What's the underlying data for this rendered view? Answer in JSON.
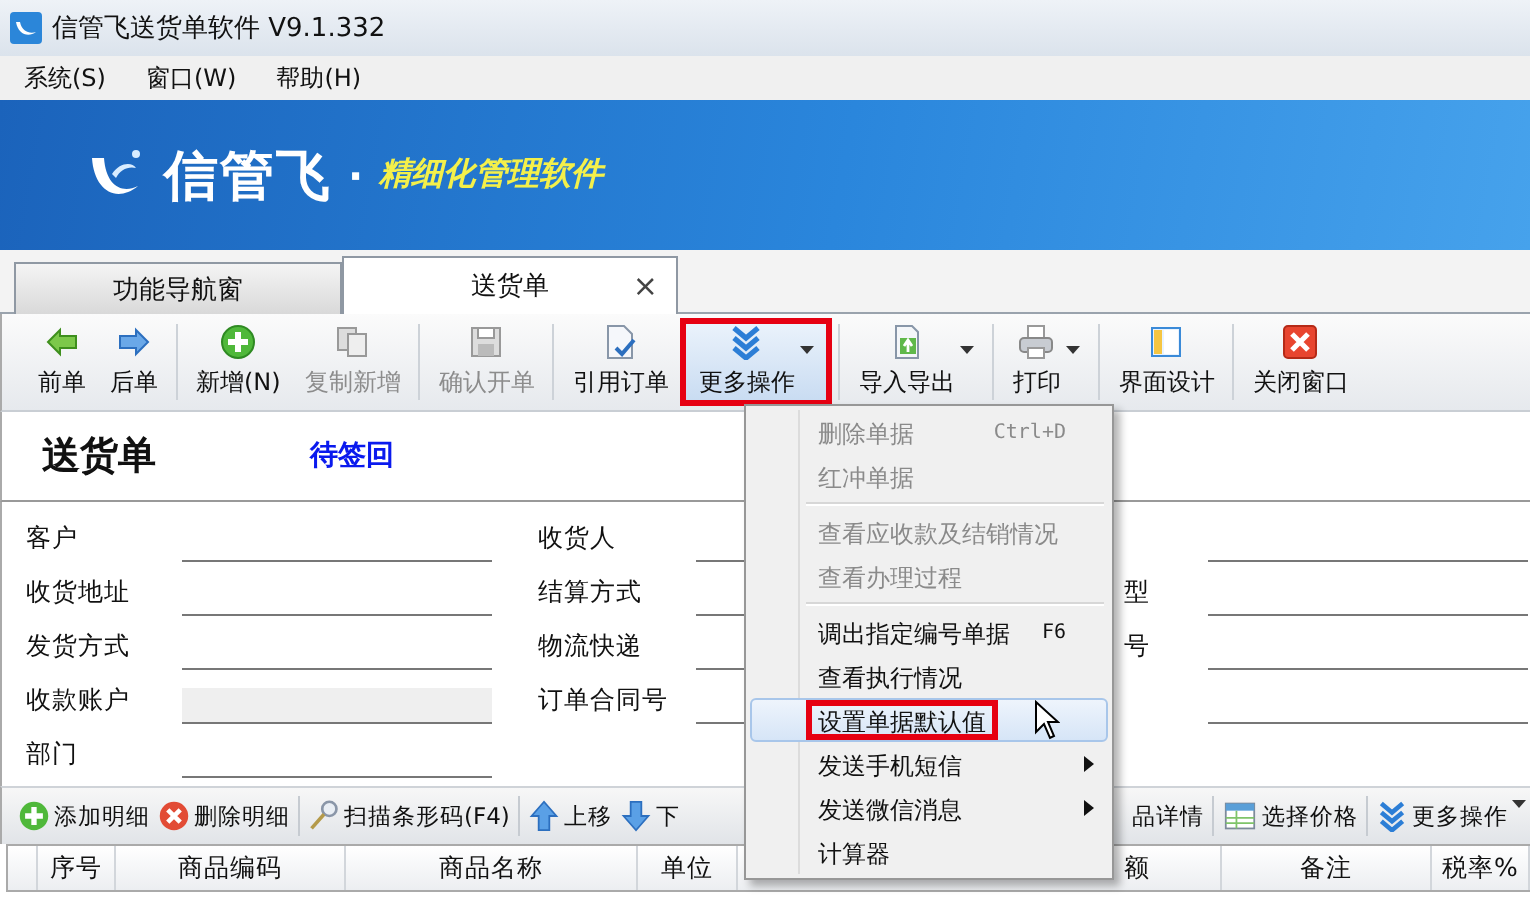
{
  "window": {
    "title": "信管飞送货单软件 V9.1.332"
  },
  "menu_bar": [
    {
      "label": "系统(S)"
    },
    {
      "label": "窗口(W)"
    },
    {
      "label": "帮助(H)"
    }
  ],
  "banner": {
    "brand": "信管飞",
    "dot": "·",
    "slogan": "精细化管理软件"
  },
  "tabs": [
    {
      "label": "功能导航窗",
      "selected": false,
      "closable": false
    },
    {
      "label": "送货单",
      "selected": true,
      "closable": true
    }
  ],
  "close_glyph": "×",
  "toolbar": [
    {
      "kind": "button",
      "label": "前单",
      "disabled": false,
      "dropdown": false,
      "highlighted": false
    },
    {
      "kind": "button",
      "label": "后单",
      "disabled": false,
      "dropdown": false,
      "highlighted": false
    },
    {
      "kind": "separator"
    },
    {
      "kind": "button",
      "label": "新增(N)",
      "disabled": false,
      "dropdown": false,
      "highlighted": false
    },
    {
      "kind": "button",
      "label": "复制新增",
      "disabled": true,
      "dropdown": false,
      "highlighted": false
    },
    {
      "kind": "separator"
    },
    {
      "kind": "button",
      "label": "确认开单",
      "disabled": true,
      "dropdown": false,
      "highlighted": false
    },
    {
      "kind": "separator"
    },
    {
      "kind": "button",
      "label": "引用订单",
      "disabled": false,
      "dropdown": false,
      "highlighted": false
    },
    {
      "kind": "button",
      "label": "更多操作",
      "disabled": false,
      "dropdown": true,
      "highlighted": true
    },
    {
      "kind": "separator"
    },
    {
      "kind": "button",
      "label": "导入导出",
      "disabled": false,
      "dropdown": true,
      "highlighted": false
    },
    {
      "kind": "separator"
    },
    {
      "kind": "button",
      "label": "打印",
      "disabled": false,
      "dropdown": true,
      "highlighted": false
    },
    {
      "kind": "separator"
    },
    {
      "kind": "button",
      "label": "界面设计",
      "disabled": false,
      "dropdown": false,
      "highlighted": false
    },
    {
      "kind": "separator"
    },
    {
      "kind": "button",
      "label": "关闭窗口",
      "disabled": false,
      "dropdown": false,
      "highlighted": false
    }
  ],
  "form": {
    "title": "送货单",
    "status": "待签回",
    "rows": [
      {
        "fields": [
          {
            "label": "客户",
            "disabled": false
          },
          {
            "label": "收货人",
            "disabled": false
          },
          {
            "disabled": false
          }
        ]
      },
      {
        "fields": [
          {
            "label": "收货地址",
            "disabled": false
          },
          {
            "label": "结算方式",
            "disabled": false
          },
          {
            "label": "型",
            "disabled": false
          }
        ]
      },
      {
        "fields": [
          {
            "label": "发货方式",
            "disabled": false
          },
          {
            "label": "物流快递",
            "disabled": false
          },
          {
            "label": "号",
            "disabled": false
          }
        ]
      },
      {
        "fields": [
          {
            "label": "收款账户",
            "disabled": true
          },
          {
            "label": "订单合同号",
            "disabled": false
          },
          {
            "disabled": false
          }
        ]
      },
      {
        "fields": [
          {
            "label": "部门",
            "disabled": false
          }
        ]
      }
    ]
  },
  "detail_toolbar": {
    "left": [
      {
        "kind": "button",
        "label": "添加明细"
      },
      {
        "kind": "button",
        "label": "删除明细"
      },
      {
        "kind": "separator"
      },
      {
        "kind": "button",
        "label": "扫描条形码(F4)"
      },
      {
        "kind": "separator"
      },
      {
        "kind": "button",
        "label": "上移"
      },
      {
        "kind": "button",
        "label": "下"
      }
    ],
    "right": [
      {
        "kind": "button",
        "label": "品详情"
      },
      {
        "kind": "separator"
      },
      {
        "kind": "button",
        "label": "选择价格"
      },
      {
        "kind": "separator"
      },
      {
        "kind": "button",
        "label": "更多操作"
      }
    ]
  },
  "table": {
    "columns": [
      "序号",
      "商品编码",
      "商品名称",
      "单位",
      "额",
      "备注",
      "税率%"
    ]
  },
  "dropdown_menu": [
    {
      "kind": "item",
      "label": "删除单据",
      "shortcut": "Ctrl+D",
      "disabled": true,
      "selected": false,
      "highlighted": false,
      "submenu": false
    },
    {
      "kind": "item",
      "label": "红冲单据",
      "disabled": true,
      "selected": false,
      "highlighted": false,
      "submenu": false
    },
    {
      "kind": "separator"
    },
    {
      "kind": "item",
      "label": "查看应收款及结销情况",
      "disabled": true,
      "selected": false,
      "highlighted": false,
      "submenu": false
    },
    {
      "kind": "item",
      "label": "查看办理过程",
      "disabled": true,
      "selected": false,
      "highlighted": false,
      "submenu": false
    },
    {
      "kind": "separator"
    },
    {
      "kind": "item",
      "label": "调出指定编号单据",
      "shortcut": "F6",
      "disabled": false,
      "selected": false,
      "highlighted": false,
      "submenu": false
    },
    {
      "kind": "item",
      "label": "查看执行情况",
      "disabled": false,
      "selected": false,
      "highlighted": false,
      "submenu": false
    },
    {
      "kind": "item",
      "label": "设置单据默认值",
      "disabled": false,
      "selected": true,
      "highlighted": true,
      "submenu": false
    },
    {
      "kind": "item",
      "label": "发送手机短信",
      "disabled": false,
      "selected": false,
      "highlighted": false,
      "submenu": true
    },
    {
      "kind": "item",
      "label": "发送微信消息",
      "disabled": false,
      "selected": false,
      "highlighted": false,
      "submenu": true
    },
    {
      "kind": "item",
      "label": "计算器",
      "disabled": false,
      "selected": false,
      "highlighted": false,
      "submenu": false
    }
  ]
}
